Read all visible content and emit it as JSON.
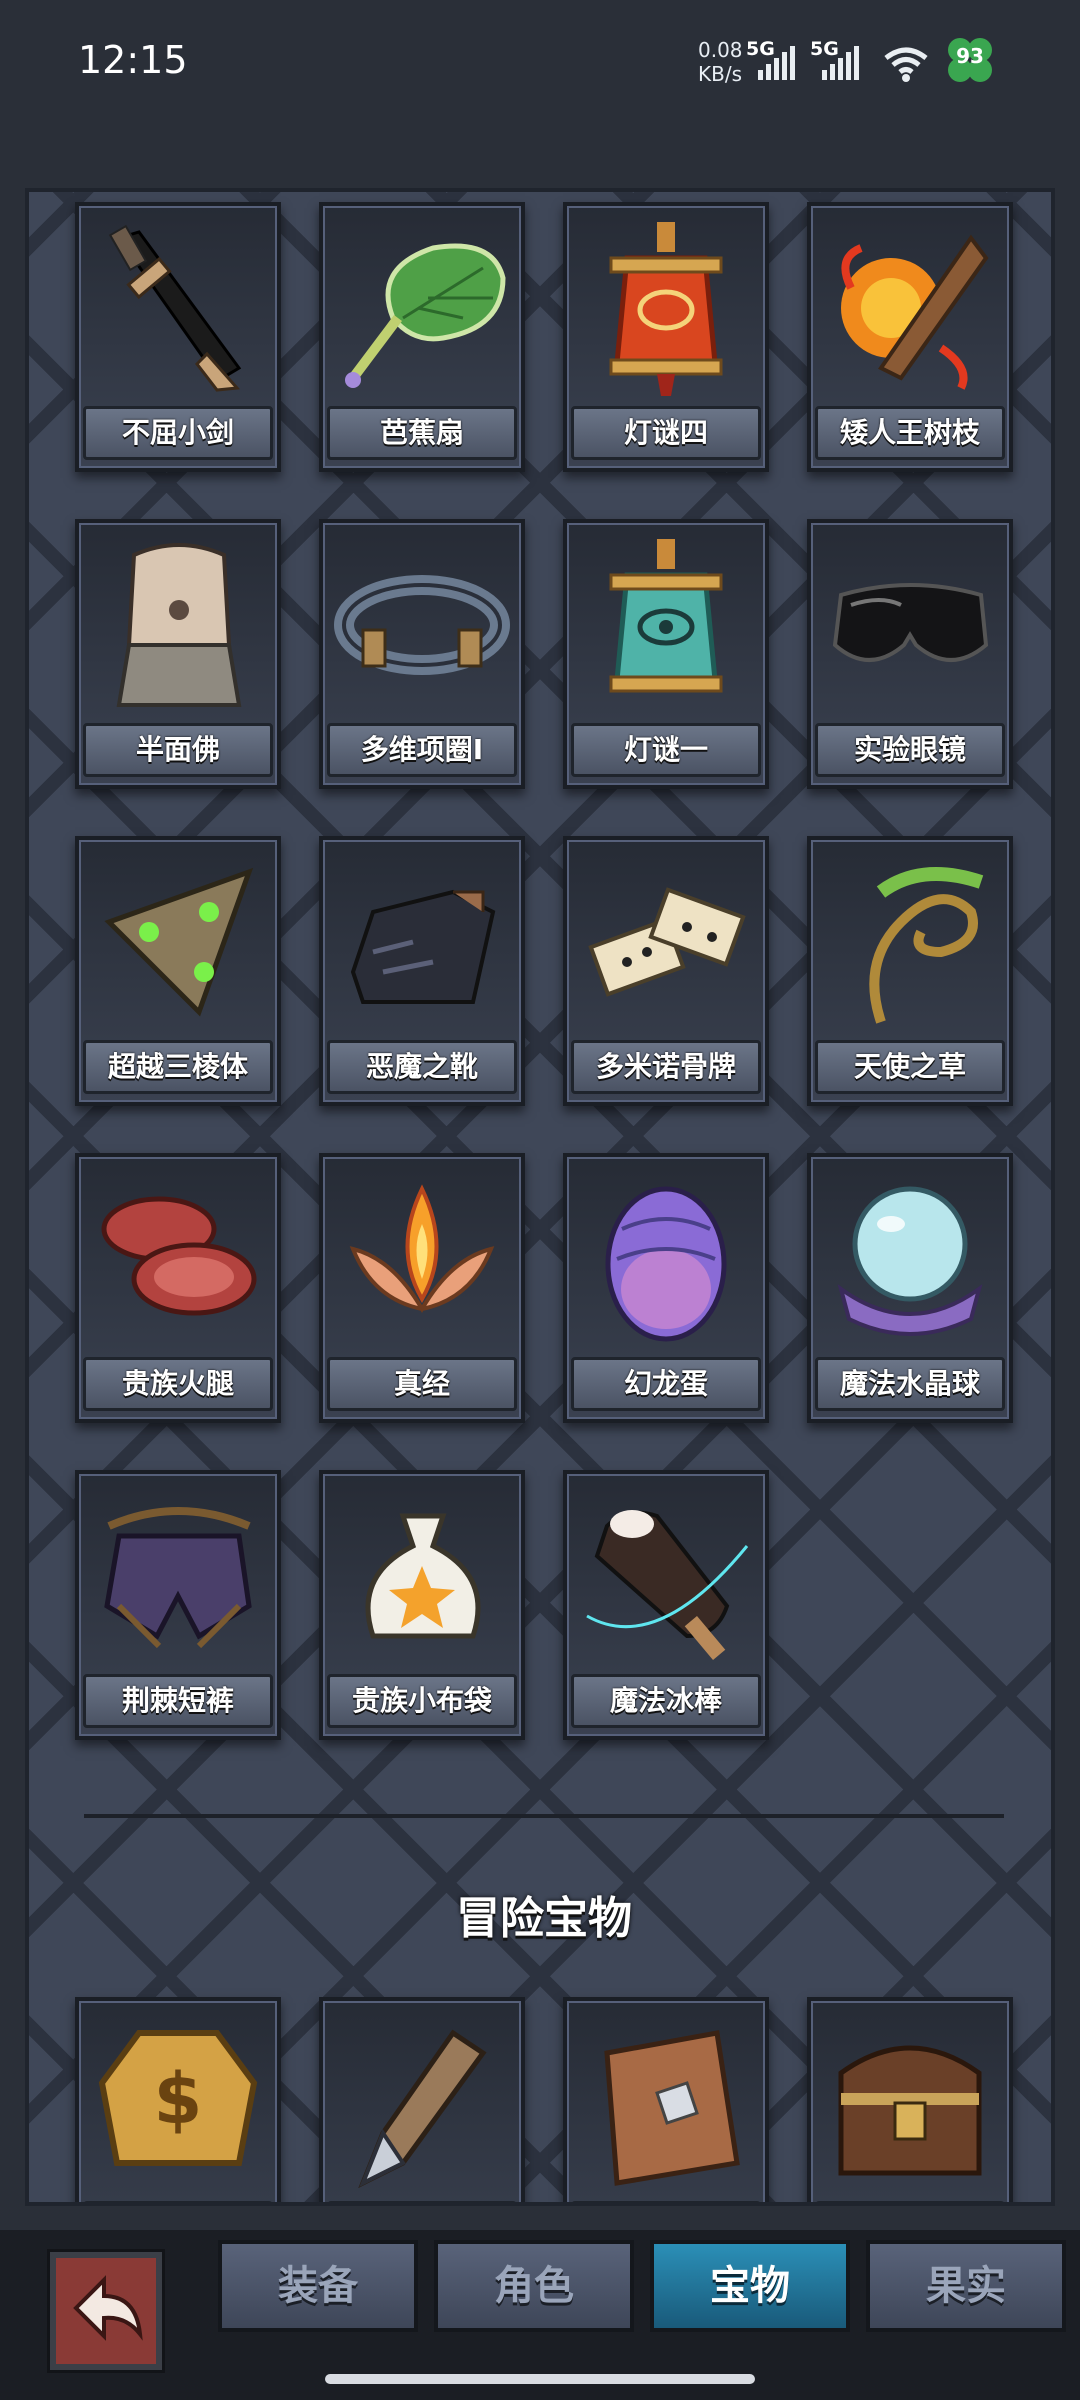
{
  "status_bar": {
    "time": "12:15",
    "net_speed": "0.08",
    "net_unit": "KB/s",
    "signal1": "5G",
    "signal2": "5G",
    "battery": "93"
  },
  "items": [
    {
      "name": "不屈小剑",
      "icon": "dagger-icon"
    },
    {
      "name": "芭蕉扇",
      "icon": "leaf-fan-icon"
    },
    {
      "name": "灯谜四",
      "icon": "red-lantern-icon"
    },
    {
      "name": "矮人王树枝",
      "icon": "burning-branch-icon"
    },
    {
      "name": "半面佛",
      "icon": "stone-bust-icon"
    },
    {
      "name": "多维项圈I",
      "icon": "collar-icon"
    },
    {
      "name": "灯谜一",
      "icon": "teal-lantern-icon"
    },
    {
      "name": "实验眼镜",
      "icon": "goggles-icon"
    },
    {
      "name": "超越三棱体",
      "icon": "prism-icon"
    },
    {
      "name": "恶魔之靴",
      "icon": "demon-boot-icon"
    },
    {
      "name": "多米诺骨牌",
      "icon": "domino-icon"
    },
    {
      "name": "天使之草",
      "icon": "fern-icon"
    },
    {
      "name": "贵族火腿",
      "icon": "ham-icon"
    },
    {
      "name": "真经",
      "icon": "lotus-flame-icon"
    },
    {
      "name": "幻龙蛋",
      "icon": "dragon-egg-icon"
    },
    {
      "name": "魔法水晶球",
      "icon": "crystal-ball-icon"
    },
    {
      "name": "荆棘短裤",
      "icon": "thorn-shorts-icon"
    },
    {
      "name": "贵族小布袋",
      "icon": "cloth-bag-icon"
    },
    {
      "name": "魔法冰棒",
      "icon": "ice-pop-icon"
    }
  ],
  "section_title": "冒险宝物",
  "adventure_items": [
    {
      "icon": "gold-coin-icon"
    },
    {
      "icon": "wrapped-knife-icon"
    },
    {
      "icon": "wood-plank-icon"
    },
    {
      "icon": "treasure-chest-icon"
    }
  ],
  "bottom_bar": {
    "back_icon": "back-arrow-icon",
    "tabs": [
      {
        "label": "装备",
        "active": false
      },
      {
        "label": "角色",
        "active": false
      },
      {
        "label": "宝物",
        "active": true
      },
      {
        "label": "果实",
        "active": false
      }
    ]
  },
  "colors": {
    "panel_bg": "#3f4758",
    "active_tab": "#2b8fb7",
    "back_button": "#8a3a36"
  }
}
